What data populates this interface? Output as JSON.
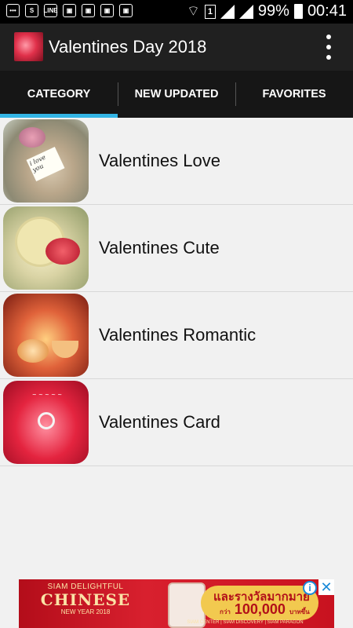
{
  "status_bar": {
    "battery_percent": "99%",
    "time": "00:41",
    "sim_slot": "1",
    "notification_icons": [
      "messaging-icon",
      "s-app-icon",
      "line-icon",
      "gift-icon",
      "gift-icon",
      "gift-icon",
      "gift-icon"
    ]
  },
  "app_bar": {
    "title": "Valentines Day 2018",
    "menu_icon": "more-vert-icon"
  },
  "tabs": [
    {
      "label": "CATEGORY",
      "selected": true
    },
    {
      "label": "NEW UPDATED",
      "selected": false
    },
    {
      "label": "FAVORITES",
      "selected": false
    }
  ],
  "accent_color": "#33b5e5",
  "categories": [
    {
      "label": "Valentines Love",
      "thumb_text": "i love you"
    },
    {
      "label": "Valentines Cute"
    },
    {
      "label": "Valentines Romantic"
    },
    {
      "label": "Valentines Card"
    }
  ],
  "ad": {
    "line1": "SIAM DELIGHTFUL",
    "line2": "CHINESE",
    "line3": "NEW YEAR 2018",
    "promo_line1": "และรางวัลมากมาย",
    "promo_line2": "100,000",
    "promo_prefix": "กว่า",
    "promo_suffix": "บาทขึ้น",
    "footer": "SIAM CENTER | SIAM DISCOVERY | SIAM PARAGON",
    "info_icon": "ⓘ",
    "close_icon": "✕"
  }
}
